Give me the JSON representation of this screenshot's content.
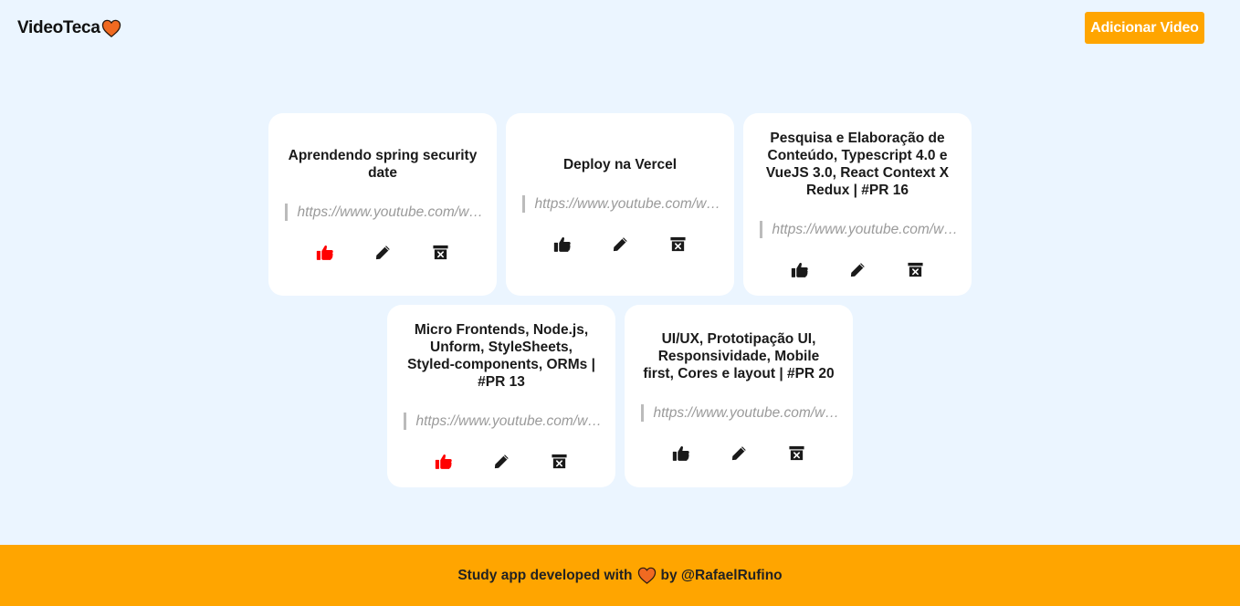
{
  "app": {
    "logo_text": "VideoTeca",
    "logo_icon": "heart-icon",
    "add_button_label": "Adicionar Video"
  },
  "colors": {
    "background": "#ebf5ff",
    "accent": "#ffa500",
    "liked": "#ff0000",
    "heart": "#f06a21"
  },
  "videos": [
    {
      "title": "Aprendendo spring security date",
      "url": "https://www.youtube.com/watch",
      "liked": true
    },
    {
      "title": "Deploy na Vercel",
      "url": "https://www.youtube.com/watch",
      "liked": false
    },
    {
      "title": "Pesquisa e Elaboração de Conteúdo, Typescript 4.0 e VueJS 3.0, React Context X Redux | #PR 16",
      "url": "https://www.youtube.com/watch",
      "liked": false
    },
    {
      "title": "Micro Frontends, Node.js, Unform, StyleSheets, Styled-components, ORMs | #PR 13",
      "url": "https://www.youtube.com/watch",
      "liked": true
    },
    {
      "title": "UI/UX, Prototipação UI, Responsividade, Mobile first, Cores e layout | #PR 20",
      "url": "https://www.youtube.com/watch",
      "liked": false
    }
  ],
  "card_icons": {
    "like": "thumbs-up-icon",
    "edit": "pencil-icon",
    "delete": "trash-icon"
  },
  "footer": {
    "text_before": "Study app developed with",
    "text_after": "by @RafaelRufino",
    "icon": "heart-icon"
  }
}
